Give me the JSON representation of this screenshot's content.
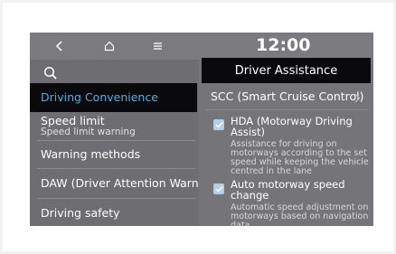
{
  "status_bar": {
    "time": "12:00"
  },
  "nav": {
    "back": "back-icon",
    "home": "home-icon",
    "menu": "menu-icon"
  },
  "sidebar": {
    "items": [
      {
        "label": "Driving Convenience"
      },
      {
        "label": "Speed limit",
        "sublabel": "Speed limit warning"
      },
      {
        "label": "Warning methods"
      },
      {
        "label": "DAW (Driver Attention Warning)"
      },
      {
        "label": "Driving safety"
      }
    ]
  },
  "panel": {
    "title": "Driver Assistance",
    "scc_label": "SCC (Smart Cruise Control)",
    "options": [
      {
        "label_line1": "HDA (Motorway Driving",
        "label_line2": "Assist)",
        "desc_line1": "Assistance for driving on",
        "desc_line2": "motorways according to the set",
        "desc_line3": "speed while keeping the vehicle",
        "desc_line4": "centred in the lane",
        "checked": true
      },
      {
        "label_line1": "Auto motorway speed",
        "label_line2": "change",
        "desc_line1": "Automatic speed adjustment on",
        "desc_line2": "motorways based on navigation",
        "desc_line3": "data",
        "checked": true
      }
    ]
  },
  "colors": {
    "accent": "#47b3f0",
    "checkbox": "#b4cfe8",
    "highlight_bg": "#0a0a0c"
  }
}
